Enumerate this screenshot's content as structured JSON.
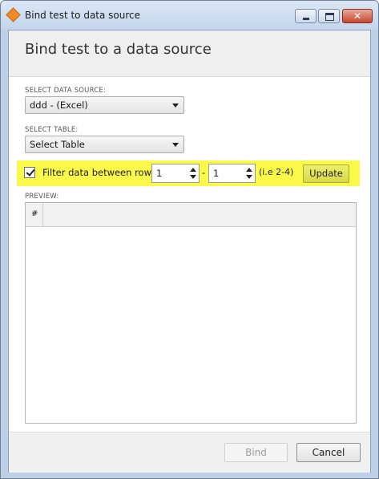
{
  "window": {
    "title": "Bind test to data source",
    "close_label": "✕"
  },
  "header": {
    "title": "Bind test to a data source"
  },
  "data_source": {
    "label": "SELECT DATA SOURCE:",
    "selected": "ddd - (Excel)"
  },
  "table": {
    "label": "SELECT TABLE:",
    "selected": "Select Table"
  },
  "filter": {
    "checked": true,
    "label": "Filter data between rows:",
    "from_value": "1",
    "separator": "-",
    "to_value": "1",
    "hint": "(i.e 2-4)",
    "update_label": "Update",
    "highlight_color": "#faf94a"
  },
  "preview": {
    "label": "PREVIEW:",
    "columns": [
      "#"
    ],
    "rows": []
  },
  "footer": {
    "bind_label": "Bind",
    "bind_enabled": false,
    "cancel_label": "Cancel"
  },
  "icons": {
    "app": "app-logo-icon",
    "minimize": "minimize-icon",
    "maximize": "maximize-icon",
    "close": "close-icon",
    "dropdown": "chevron-down-icon",
    "spin_up": "arrow-up-icon",
    "spin_down": "arrow-down-icon",
    "check": "check-icon"
  }
}
